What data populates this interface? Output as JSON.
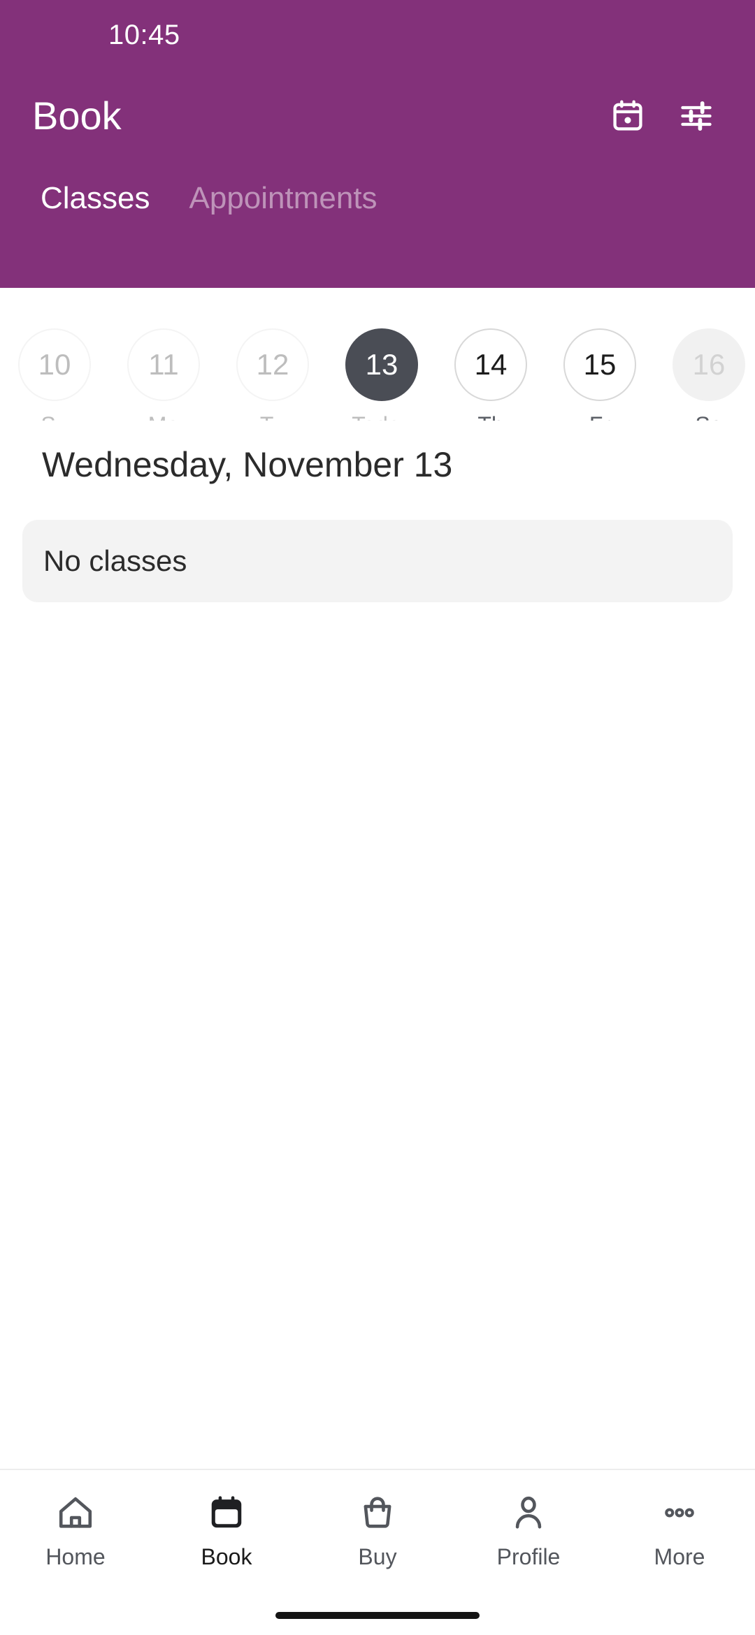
{
  "status_bar": {
    "time": "10:45"
  },
  "header": {
    "title": "Book",
    "background_color": "#83317a",
    "actions": [
      {
        "name": "calendar-icon",
        "label": "Calendar"
      },
      {
        "name": "filter-icon",
        "label": "Filters"
      }
    ],
    "tabs": [
      {
        "label": "Classes",
        "active": true
      },
      {
        "label": "Appointments",
        "active": false
      }
    ]
  },
  "date_strip": {
    "days": [
      {
        "date": "10",
        "weekday": "Su",
        "state": "past"
      },
      {
        "date": "11",
        "weekday": "Mo",
        "state": "past"
      },
      {
        "date": "12",
        "weekday": "Tu",
        "state": "past"
      },
      {
        "date": "13",
        "weekday": "Today",
        "state": "selected"
      },
      {
        "date": "14",
        "weekday": "Th",
        "state": "available"
      },
      {
        "date": "15",
        "weekday": "Fr",
        "state": "available"
      },
      {
        "date": "16",
        "weekday": "Sa",
        "state": "disabled"
      }
    ]
  },
  "main": {
    "date_heading": "Wednesday, November 13",
    "empty_state": "No classes"
  },
  "bottom_nav": {
    "items": [
      {
        "label": "Home",
        "icon": "home-icon",
        "active": false
      },
      {
        "label": "Book",
        "icon": "calendar-icon",
        "active": true
      },
      {
        "label": "Buy",
        "icon": "shopping-bag-icon",
        "active": false
      },
      {
        "label": "Profile",
        "icon": "person-icon",
        "active": false
      },
      {
        "label": "More",
        "icon": "more-dots-icon",
        "active": false
      }
    ]
  },
  "colors": {
    "brand_purple": "#83317a",
    "selected_day": "#4a4d55",
    "card_background": "#f3f3f3",
    "text_primary": "#2b2b2b",
    "text_muted": "#bdbdbd"
  }
}
